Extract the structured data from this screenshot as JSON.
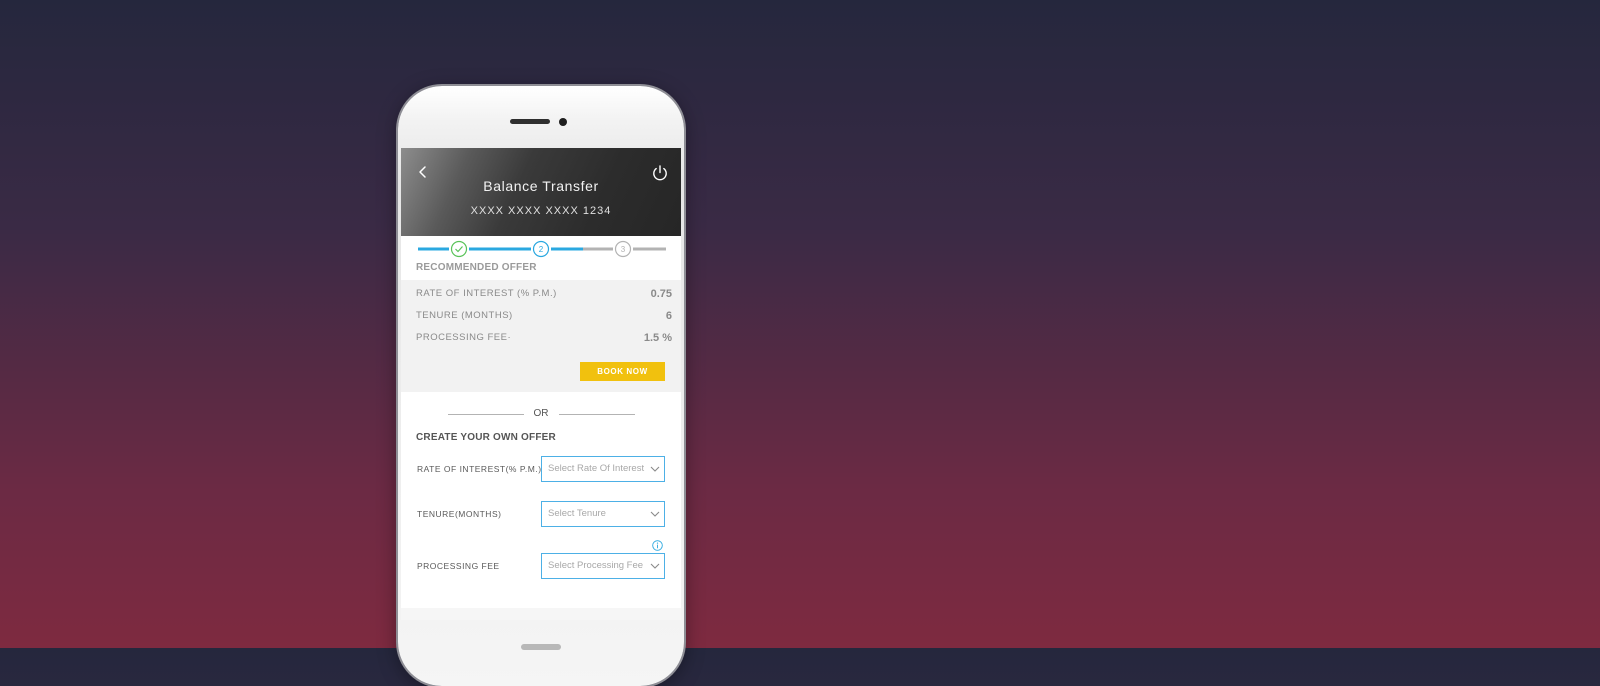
{
  "header": {
    "title": "Balance Transfer",
    "card_number": "XXXX XXXX XXXX 1234",
    "back_icon": "chevron-left-icon",
    "power_icon": "power-icon"
  },
  "stepper": {
    "steps": [
      "1",
      "2",
      "3"
    ],
    "current_step": 2,
    "completed_color": "#5ac35a",
    "active_color": "#2aa8e0",
    "inactive_color": "#b3b3b3"
  },
  "recommended_offer": {
    "title": "RECOMMENDED OFFER",
    "rows": [
      {
        "label": "RATE OF INTEREST (% P.M.)",
        "value": "0.75"
      },
      {
        "label": "TENURE (MONTHS)",
        "value": "6"
      },
      {
        "label": "PROCESSING FEE·",
        "value": "1.5 %"
      }
    ],
    "book_now_label": "BOOK NOW",
    "button_color": "#f1c10e"
  },
  "divider": {
    "or_text": "OR"
  },
  "create_offer": {
    "title": "CREATE YOUR OWN OFFER",
    "fields": [
      {
        "label": "RATE OF INTEREST(% P.M.)",
        "placeholder": "Select Rate Of Interest"
      },
      {
        "label": "TENURE(MONTHS)",
        "placeholder": "Select Tenure"
      },
      {
        "label": "PROCESSING FEE",
        "placeholder": "Select Processing Fee"
      }
    ],
    "info_icon": "info-icon",
    "field_border_color": "#4db0e6"
  }
}
